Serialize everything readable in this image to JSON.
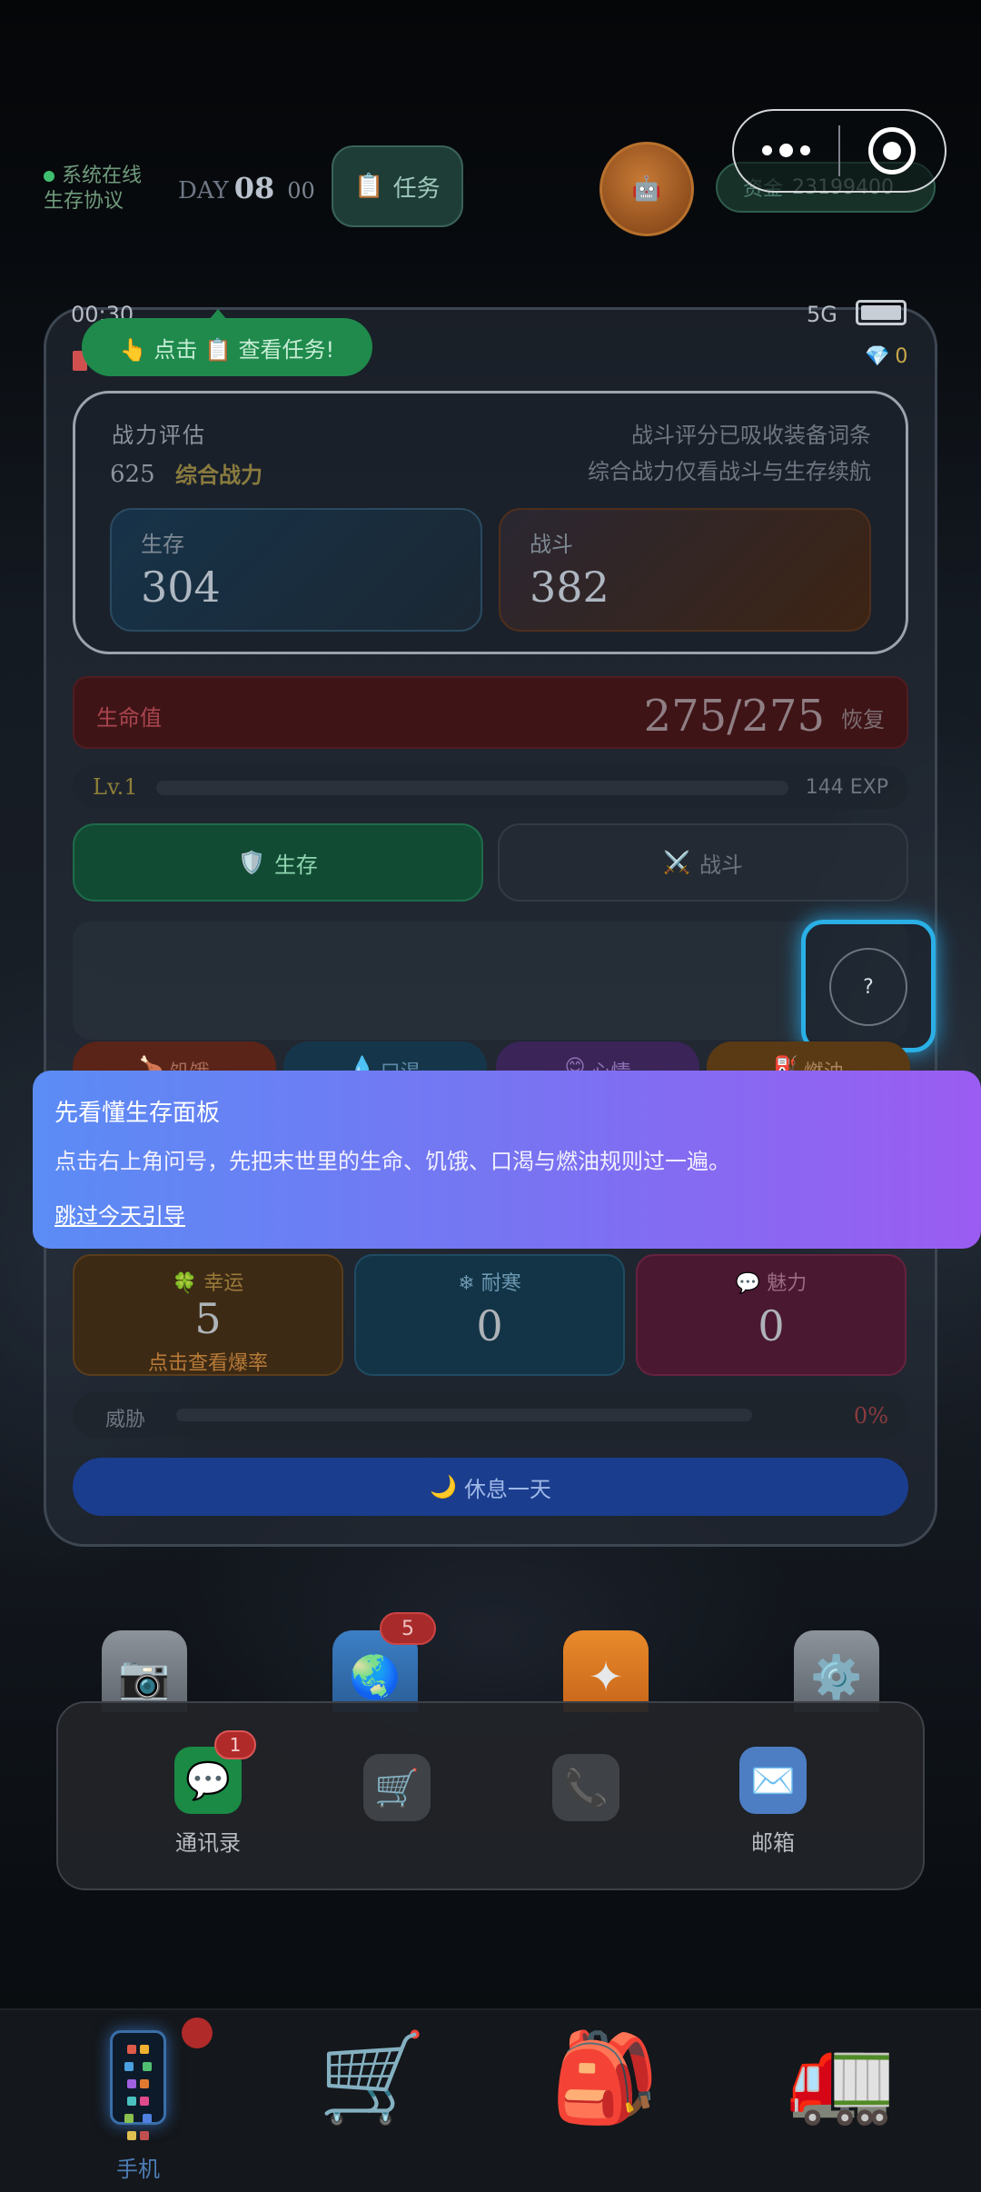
{
  "top": {
    "status_online": "系统在线",
    "status_protocol": "生存协议",
    "day_label": "DAY",
    "day_num": "08",
    "day_min": "00",
    "task_label": "任务",
    "funds_label": "资金",
    "funds_value": "23199400"
  },
  "phone": {
    "time": "00:30",
    "network": "5G",
    "gems": "0",
    "hint": "👆 点击 📋 查看任务!"
  },
  "power": {
    "title": "战力评估",
    "value": "625",
    "composite_label": "综合战力",
    "note1": "战斗评分已吸收装备词条",
    "note2": "综合战力仅看战斗与生存续航",
    "survival_label": "生存",
    "survival_value": "304",
    "combat_label": "战斗",
    "combat_value": "382"
  },
  "life": {
    "label": "生命值",
    "value": "275/275",
    "recover": "恢复"
  },
  "level": {
    "label": "Lv.1",
    "exp": "144 EXP",
    "progress": 0
  },
  "tabs": {
    "survival": "生存",
    "combat": "战斗"
  },
  "help": {
    "symbol": "?"
  },
  "needs": {
    "hunger": "饥饿",
    "thirst": "口渴",
    "mood": "心情",
    "fuel": "燃油"
  },
  "tip": {
    "title": "先看懂生存面板",
    "body": "点击右上角问号，先把末世里的生命、饥饿、口渴与燃油规则过一遍。",
    "skip": "跳过今天引导"
  },
  "attrs": {
    "luck_label": "幸运",
    "luck_value": "5",
    "luck_sub": "点击查看爆率",
    "cold_label": "耐寒",
    "cold_value": "0",
    "charm_label": "魅力",
    "charm_value": "0"
  },
  "threat": {
    "label": "威胁",
    "value": "0%"
  },
  "rest": {
    "label": "休息一天"
  },
  "apps": {
    "globe_badge": "5"
  },
  "dock": {
    "contacts_label": "通讯录",
    "contacts_badge": "1",
    "mail_label": "邮箱"
  },
  "nav": {
    "phone_label": "手机"
  }
}
